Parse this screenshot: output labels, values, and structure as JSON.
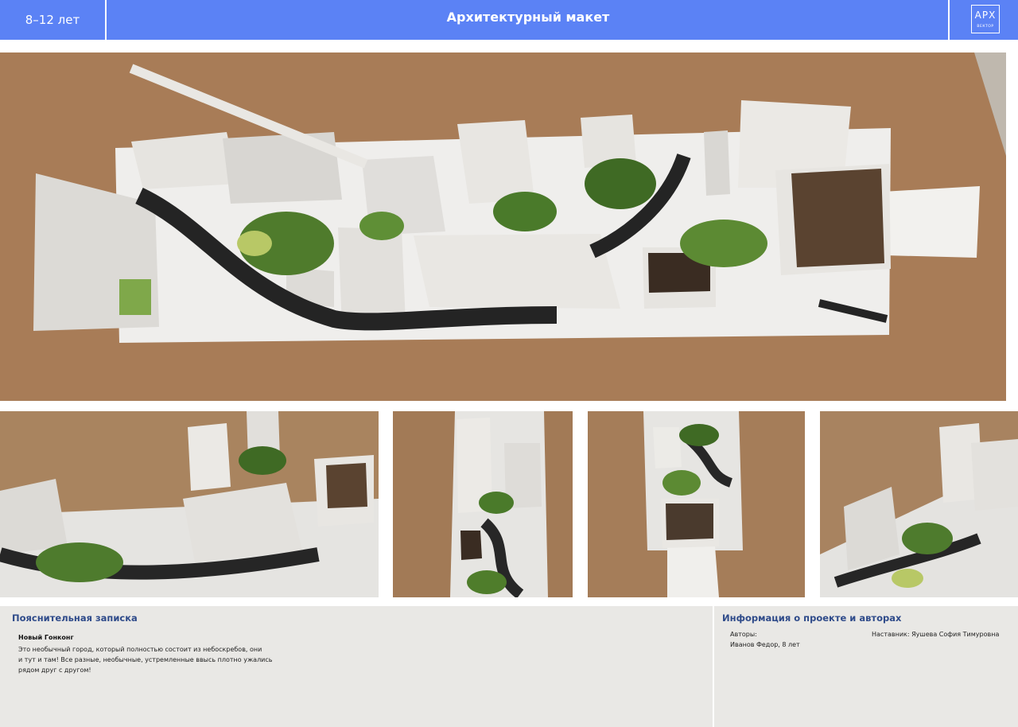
{
  "header": {
    "age_group": "8–12 лет",
    "title": "Архитектурный макет",
    "logo_main": "АРХ",
    "logo_sub": "ВЕКТОР"
  },
  "explanatory_note": {
    "heading": "Пояснительная записка",
    "project_title": "Новый Гонконг",
    "lines": [
      "Это необычный город, который полностью состоит из небоскребов, они",
      "и тут и там! Все разные, необычные, устремленные ввысь плотно ужались",
      "рядом друг с другом!"
    ]
  },
  "project_info": {
    "heading": "Информация о проекте и авторах",
    "authors_label": "Авторы:",
    "authors": "Иванов Федор, 8 лет",
    "mentor": "Наставник: Яушева София Тимуровна"
  },
  "colors": {
    "header_blue": "#5b82f5",
    "heading_blue": "#2f4b8a",
    "panel_gray": "#e9e8e5",
    "cardboard": "#a87c57"
  }
}
